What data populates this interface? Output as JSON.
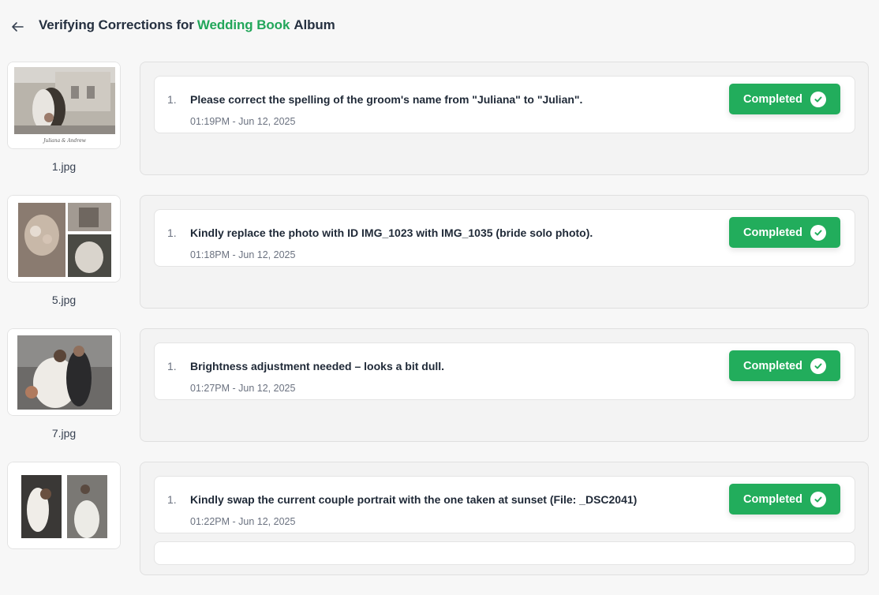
{
  "header": {
    "title_prefix": "Verifying Corrections for",
    "album_name": "Wedding Book",
    "title_suffix": "Album",
    "accent_color": "#22a65a"
  },
  "status_color": "#22ad5c",
  "rows": [
    {
      "file": "1.jpg",
      "corrections": [
        {
          "num": "1.",
          "text": "Please correct the spelling of the groom's name from \"Juliana\" to \"Julian\".",
          "time": "01:19PM - Jun 12, 2025",
          "status": "Completed"
        }
      ]
    },
    {
      "file": "5.jpg",
      "corrections": [
        {
          "num": "1.",
          "text": "Kindly replace the photo with ID IMG_1023 with IMG_1035 (bride solo photo).",
          "time": "01:18PM - Jun 12, 2025",
          "status": "Completed"
        }
      ]
    },
    {
      "file": "7.jpg",
      "corrections": [
        {
          "num": "1.",
          "text": "Brightness adjustment needed – looks a bit dull.",
          "time": "01:27PM - Jun 12, 2025",
          "status": "Completed"
        }
      ]
    },
    {
      "file": "",
      "corrections": [
        {
          "num": "1.",
          "text": "Kindly swap the current couple portrait with the one taken at sunset (File: _DSC2041)",
          "time": "01:22PM - Jun 12, 2025",
          "status": "Completed"
        }
      ]
    }
  ]
}
